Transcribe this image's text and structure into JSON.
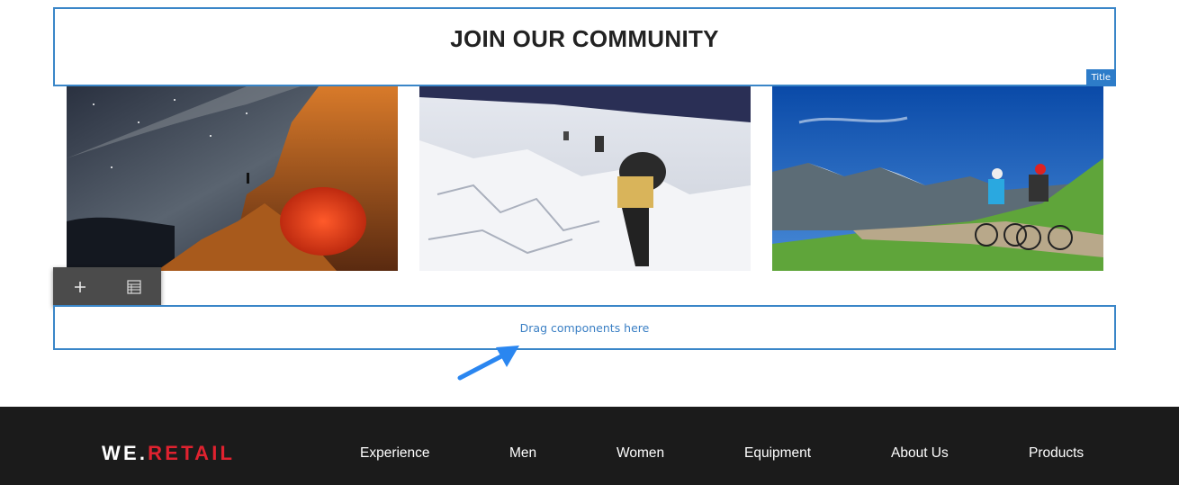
{
  "title_component": {
    "heading": "JOIN OUR COMMUNITY",
    "tag_label": "Title"
  },
  "images": [
    {
      "name": "Camping under the Milky Way"
    },
    {
      "name": "Climbers on a glacier"
    },
    {
      "name": "Mountain bikers on an alpine trail"
    }
  ],
  "toolbar": {
    "add_icon": "plus-icon",
    "parent_icon": "list-icon"
  },
  "drop_zone": {
    "label": "Drag components here"
  },
  "footer": {
    "logo_part1": "WE.",
    "logo_part2": "RETAIL",
    "nav": [
      "Experience",
      "Men",
      "Women",
      "Equipment",
      "About Us",
      "Products"
    ]
  },
  "colors": {
    "editor_blue": "#3a86c8",
    "footer_bg": "#1b1b1b",
    "logo_red": "#e0222f"
  }
}
